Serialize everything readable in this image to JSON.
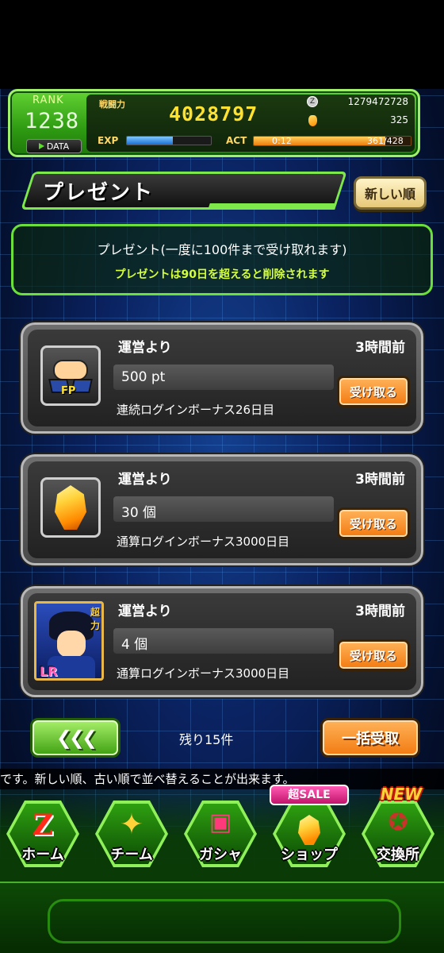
{
  "status": {
    "rank_label": "RANK",
    "rank": "1238",
    "data_button": "DATA",
    "power_label": "戦闘力",
    "power": "4028797",
    "zeni": "1279472728",
    "dragon_stones": "325",
    "exp_label": "EXP",
    "exp_progress": 0.55,
    "act_label": "ACT",
    "act_timer": "0:12",
    "act_count": "361/428",
    "act_progress": 0.84
  },
  "title": {
    "text": "プレゼント",
    "sort_button": "新しい順"
  },
  "notice": {
    "line1": "プレゼント(一度に100件まで受け取れます)",
    "line2": "プレゼントは90日を超えると削除されます"
  },
  "presents": [
    {
      "from": "運営より",
      "time": "3時間前",
      "amount": "500 pt",
      "reason": "連続ログインボーナス26日目",
      "claim_label": "受け取る",
      "icon": "friend-points-icon",
      "icon_text": "FP"
    },
    {
      "from": "運営より",
      "time": "3時間前",
      "amount": "30 個",
      "reason": "通算ログインボーナス3000日目",
      "claim_label": "受け取る",
      "icon": "dragon-stone-icon"
    },
    {
      "from": "運営より",
      "time": "3時間前",
      "amount": "4 個",
      "reason": "通算ログインボーナス3000日目",
      "claim_label": "受け取る",
      "icon": "character-card-icon",
      "card_type": "超力",
      "card_rarity": "LR"
    }
  ],
  "pager": {
    "prev_label": "❮❮❮",
    "remaining": "残り15件",
    "claim_all_label": "一括受取"
  },
  "ticker": "です。新しい順、古い順で並べ替えることが出来ます。",
  "nav": {
    "items": [
      {
        "label": "ホーム",
        "icon": "z-logo-icon",
        "glyph": "Z"
      },
      {
        "label": "チーム",
        "icon": "team-icon",
        "glyph": "✦"
      },
      {
        "label": "ガシャ",
        "icon": "gacha-icon",
        "glyph": "▣"
      },
      {
        "label": "ショップ",
        "icon": "shop-stone-icon"
      },
      {
        "label": "交換所",
        "icon": "exchange-icon",
        "glyph": "✪"
      }
    ],
    "sale_badge": "超SALE",
    "new_badge": "NEW"
  },
  "colors": {
    "accent_green": "#6ce03a",
    "claim_orange": "#f27a10",
    "power_yellow": "#ffe230",
    "notice_yellow": "#d4ff3a"
  }
}
